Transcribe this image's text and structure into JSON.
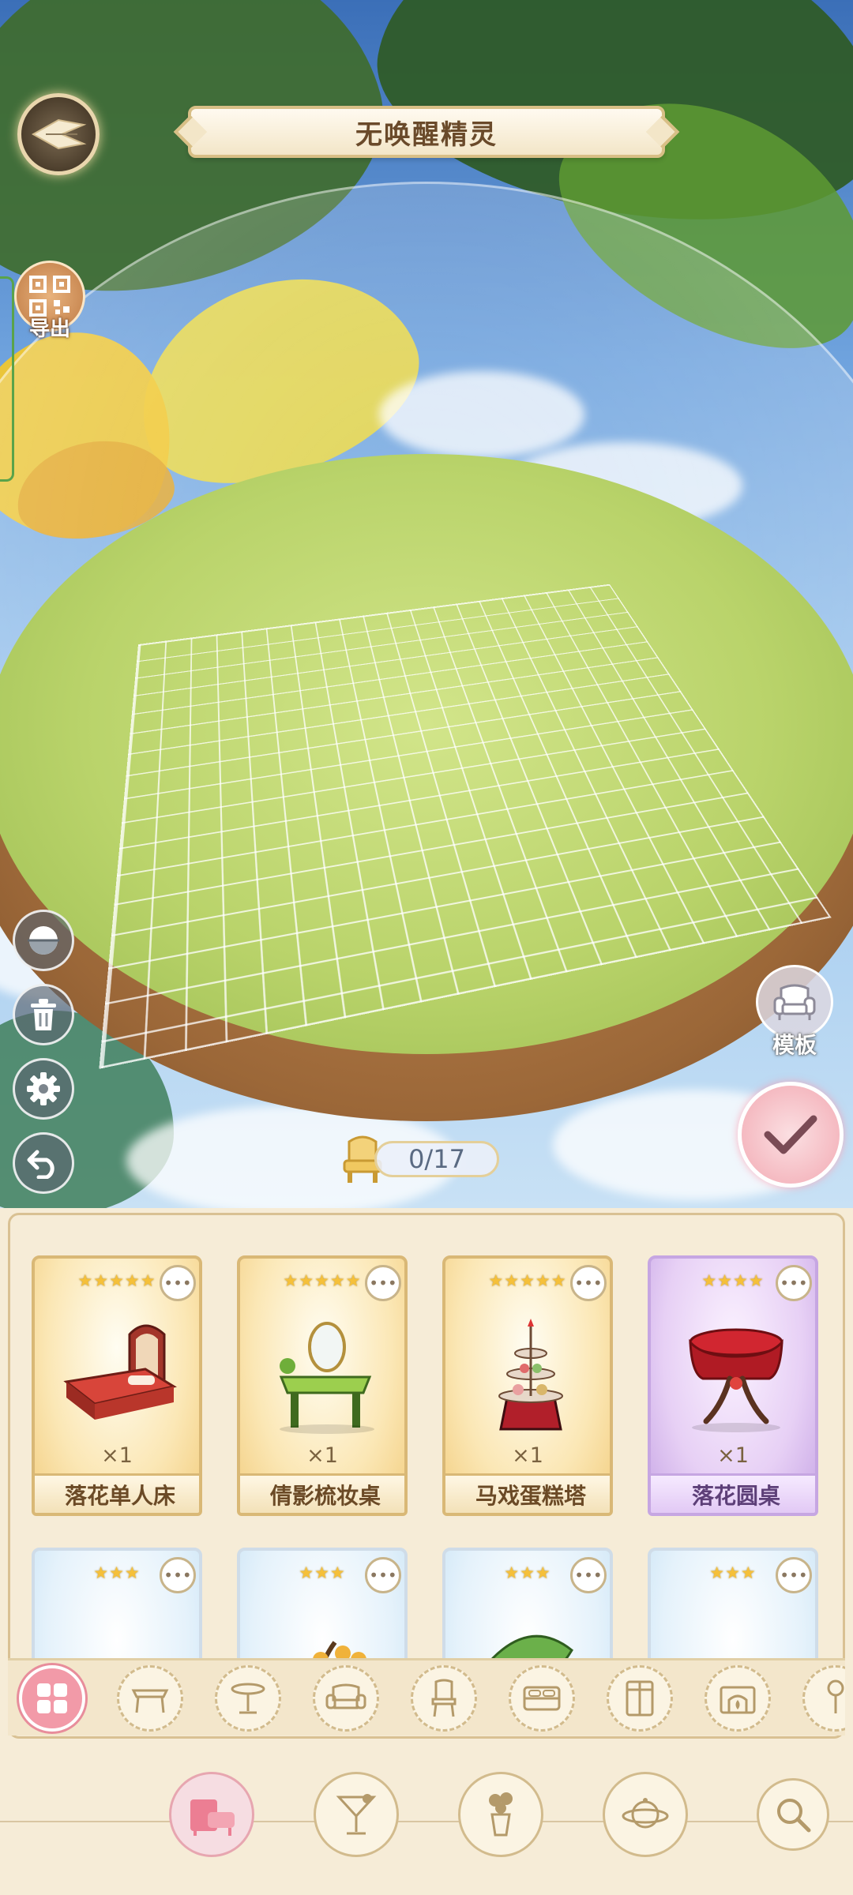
{
  "header": {
    "title": "无唤醒精灵"
  },
  "left_tools": {
    "export_label": "导出"
  },
  "right_tools": {
    "template_label": "模板"
  },
  "placement": {
    "counter": "0/17"
  },
  "items": [
    {
      "name": "落花单人床",
      "qty": "×1",
      "stars": "★★★★★",
      "rarity": "gold"
    },
    {
      "name": "倩影梳妆桌",
      "qty": "×1",
      "stars": "★★★★★",
      "rarity": "gold"
    },
    {
      "name": "马戏蛋糕塔",
      "qty": "×1",
      "stars": "★★★★★",
      "rarity": "gold"
    },
    {
      "name": "落花圆桌",
      "qty": "×1",
      "stars": "★★★★",
      "rarity": "purple"
    },
    {
      "stars": "★★★",
      "rarity": "blue"
    },
    {
      "stars": "★★★",
      "rarity": "blue"
    },
    {
      "stars": "★★★",
      "rarity": "blue"
    },
    {
      "stars": "★★★",
      "rarity": "blue"
    }
  ],
  "more_label": "•••",
  "categories": [
    "all-icon",
    "table-icon",
    "round-table-icon",
    "sofa-icon",
    "chair-icon",
    "bed-icon",
    "cabinet-icon",
    "fireplace-icon",
    "lamp-icon"
  ],
  "bottom_nav": [
    "furniture-icon",
    "cocktail-icon",
    "flower-vase-icon",
    "planet-icon",
    "search-icon"
  ],
  "colors": {
    "accent_pink": "#f29aa8",
    "gold_frame": "#d9b876",
    "grass": "#b9d36a"
  }
}
